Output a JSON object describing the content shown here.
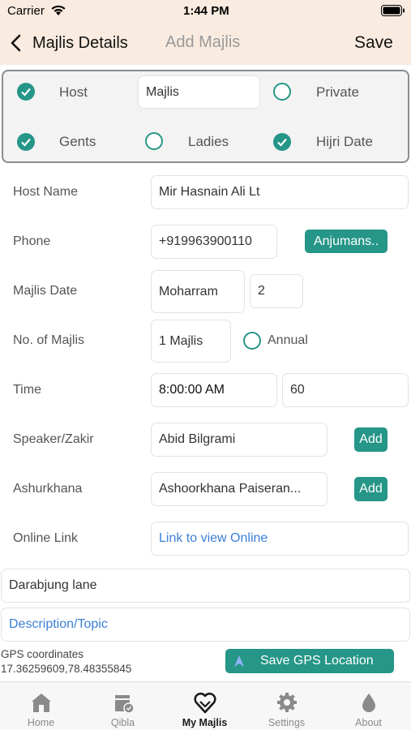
{
  "status_bar": {
    "carrier": "Carrier",
    "time": "1:44 PM"
  },
  "nav": {
    "back_label": "Majlis Details",
    "title": "Add Majlis",
    "save_label": "Save"
  },
  "options": {
    "host": {
      "label": "Host",
      "checked": true
    },
    "host_value": "Majlis",
    "private": {
      "label": "Private",
      "checked": false
    },
    "gents": {
      "label": "Gents",
      "checked": true
    },
    "ladies": {
      "label": "Ladies",
      "checked": false
    },
    "hijri": {
      "label": "Hijri Date",
      "checked": true
    }
  },
  "form": {
    "host_name": {
      "label": "Host Name",
      "value": "Mir Hasnain Ali Lt"
    },
    "phone": {
      "label": "Phone",
      "value": "+919963900110",
      "button": "Anjumans.."
    },
    "date": {
      "label": "Majlis Date",
      "month": "Moharram",
      "day": "2"
    },
    "count": {
      "label": "No. of Majlis",
      "value": "1 Majlis",
      "annual_label": "Annual"
    },
    "time": {
      "label": "Time",
      "value": "8:00:00 AM",
      "duration": "60"
    },
    "speaker": {
      "label": "Speaker/Zakir",
      "value": "Abid Bilgrami",
      "button": "Add"
    },
    "ashurkhana": {
      "label": "Ashurkhana",
      "value": "Ashoorkhana Paiseran...",
      "button": "Add"
    },
    "online": {
      "label": "Online Link",
      "placeholder": "Link to view Online"
    },
    "address": "Darabjung lane",
    "description_placeholder": "Description/Topic",
    "gps_label": "GPS coordinates",
    "gps_value": "17.36259609,78.48355845",
    "gps_button": "Save GPS Location"
  },
  "tabs": [
    {
      "label": "Home",
      "icon": "home-icon"
    },
    {
      "label": "Qibla",
      "icon": "qibla-icon"
    },
    {
      "label": "My Majlis",
      "icon": "my-majlis-icon",
      "active": true
    },
    {
      "label": "Settings",
      "icon": "gear-icon"
    },
    {
      "label": "About",
      "icon": "drop-icon"
    }
  ],
  "colors": {
    "accent": "#259688",
    "nav_bg": "#f9ebe0",
    "link": "#3a7fd5"
  }
}
